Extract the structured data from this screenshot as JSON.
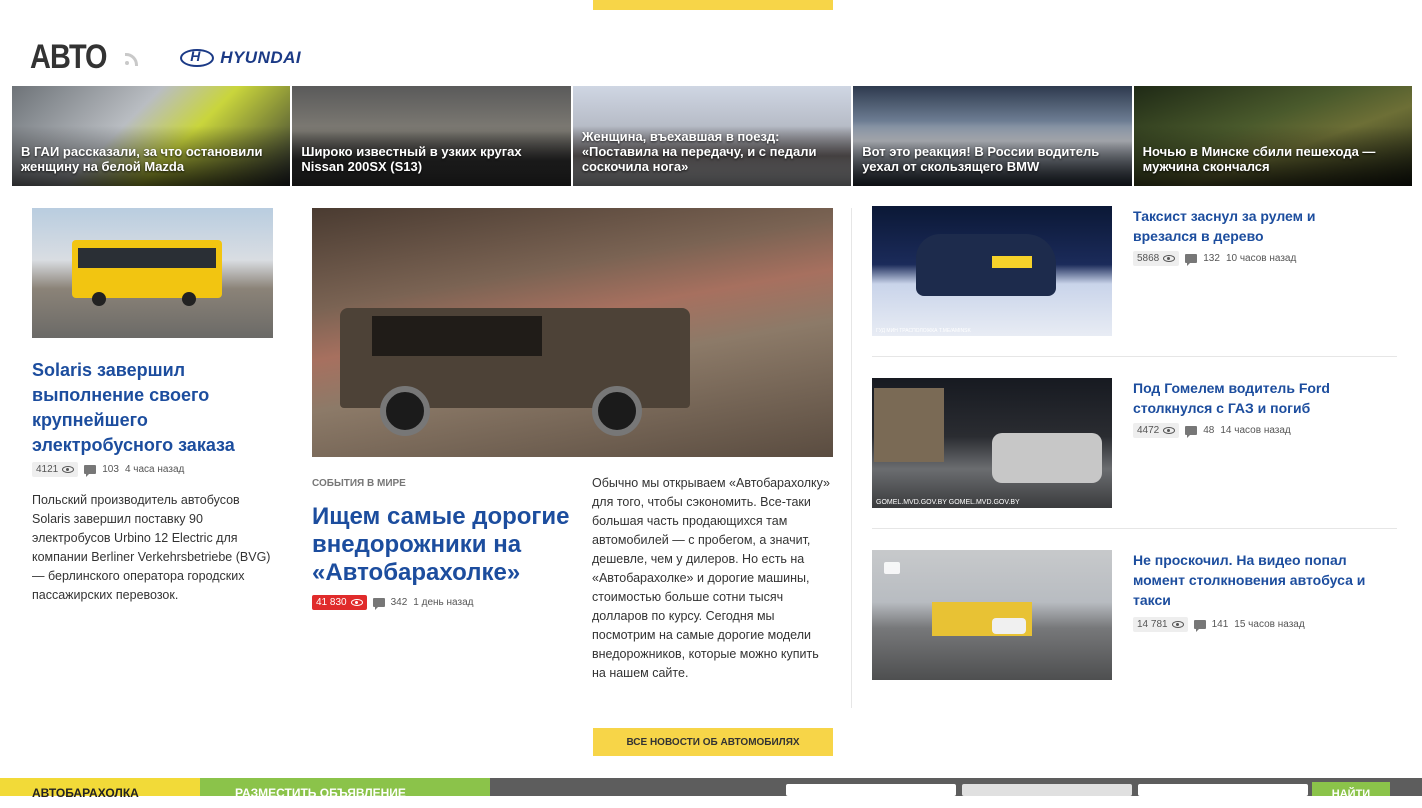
{
  "header": {
    "title": "АВТО",
    "brand_name": "HYUNDAI"
  },
  "strip": [
    {
      "caption": "В ГАИ рассказали, за что остановили женщину на белой Mazda"
    },
    {
      "caption": "Широко известный в узких кругах Nissan 200SX (S13)"
    },
    {
      "caption": "Женщина, въехавшая в поезд: «Поставила на передачу, и с педали соскочила нога»"
    },
    {
      "caption": "Вот это реакция! В России водитель уехал от скользящего BMW"
    },
    {
      "caption": "Ночью в Минске сбили пешехода — мужчина скончался"
    }
  ],
  "left_article": {
    "title": "Solaris завершил выполнение своего крупнейшего электробусного заказа",
    "views": "4121",
    "comments": "103",
    "time": "4 часа назад",
    "lead": "Польский производитель автобусов Solaris завершил поставку 90 электробусов Urbino 12 Electric для компании Berliner Verkehrsbetriebe (BVG) — берлинского оператора городских пассажирских перевозок."
  },
  "main_article": {
    "category": "СОБЫТИЯ В МИРЕ",
    "title": "Ищем самые дорогие внедорожники на «Автобарахолке»",
    "views": "41 830",
    "comments": "342",
    "time": "1 день назад",
    "lead": "Обычно мы открываем «Автобарахолку» для того, чтобы сэкономить. Все-таки большая часть продающихся там автомобилей — с пробегом, а значит, дешевле, чем у дилеров. Но есть на «Автобарахолке» и дорогие машины, стоимостью больше сотни тысяч долларов по курсу. Сегодня мы посмотрим на самые дорогие модели внедорожников, которые можно купить на нашем сайте."
  },
  "right_articles": [
    {
      "title": "Таксист заснул за рулем и врезался в дерево",
      "views": "5868",
      "comments": "132",
      "time": "10 часов назад",
      "overlay": "ГУД МИН ТРАСПОЛОЖКА   T.ME/AMINSK"
    },
    {
      "title": "Под Гомелем водитель Ford столкнулся с ГАЗ и погиб",
      "views": "4472",
      "comments": "48",
      "time": "14 часов назад",
      "overlay": "GOMEL.MVD.GOV.BY      GOMEL.MVD.GOV.BY"
    },
    {
      "title": "Не проскочил. На видео попал момент столкновения автобуса и такси",
      "views": "14 781",
      "comments": "141",
      "time": "15 часов назад",
      "overlay": ""
    }
  ],
  "all_news_label": "ВСЕ НОВОСТИ ОБ АВТОМОБИЛЯХ",
  "bottom_bar": {
    "autobaraholka": "АВТОБАРАХОЛКА",
    "post_ad": "РАЗМЕСТИТЬ ОБЪЯВЛЕНИЕ",
    "find_button": "НАЙТИ"
  },
  "colors": {
    "accent_yellow": "#f7d548",
    "headline_blue": "#1c4d9e",
    "hot_red": "#e02b2b",
    "green": "#8bc34a"
  }
}
